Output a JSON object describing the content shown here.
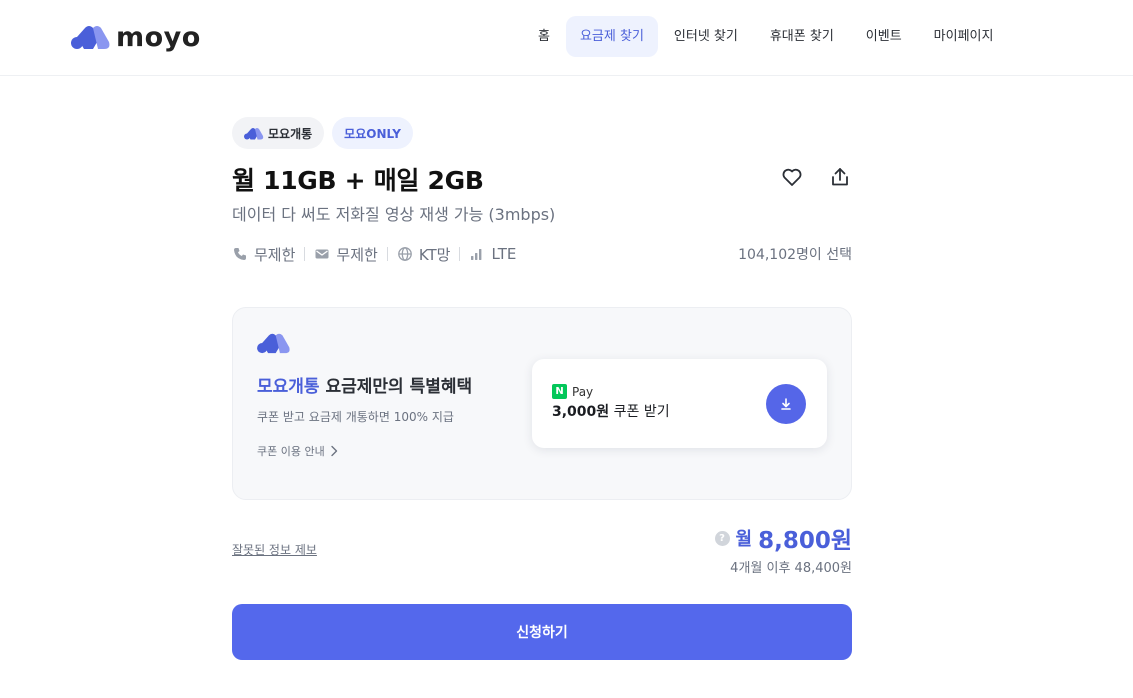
{
  "header": {
    "logo_text": "moyo",
    "nav": [
      {
        "label": "홈"
      },
      {
        "label": "요금제 찾기",
        "active": true
      },
      {
        "label": "인터넷 찾기"
      },
      {
        "label": "휴대폰 찾기"
      },
      {
        "label": "이벤트"
      },
      {
        "label": "마이페이지"
      }
    ]
  },
  "plan": {
    "chips": [
      "모요개통",
      "모요ONLY"
    ],
    "title": "월 11GB + 매일 2GB",
    "subtitle": "데이터 다 써도 저화질 영상 재생 가능 (3mbps)",
    "specs": [
      {
        "icon": "phone-icon",
        "label": "무제한"
      },
      {
        "icon": "mail-icon",
        "label": "무제한"
      },
      {
        "icon": "globe-icon",
        "label": "KT망"
      },
      {
        "icon": "signal-icon",
        "label": "LTE"
      }
    ],
    "select_count": "104,102명이 선택"
  },
  "promo": {
    "title_highlight": "모요개통",
    "title_rest": " 요금제만의 특별혜택",
    "description": "쿠폰 받고 요금제 개통하면 100% 지급",
    "link": "쿠폰 이용 안내",
    "coupon": {
      "pay_badge": "N",
      "pay_label": "Pay",
      "amount": "3,000원",
      "action": " 쿠폰 받기"
    }
  },
  "footer": {
    "report_link": "잘못된 정보 제보",
    "price_help": "?",
    "price_prefix": "월",
    "price": "8,800원",
    "price_after": "4개월 이후 48,400원",
    "apply_button": "신청하기"
  },
  "colors": {
    "brand": "#4a5fd9",
    "apply_button": "#5468ec",
    "npay_green": "#03c75a"
  }
}
